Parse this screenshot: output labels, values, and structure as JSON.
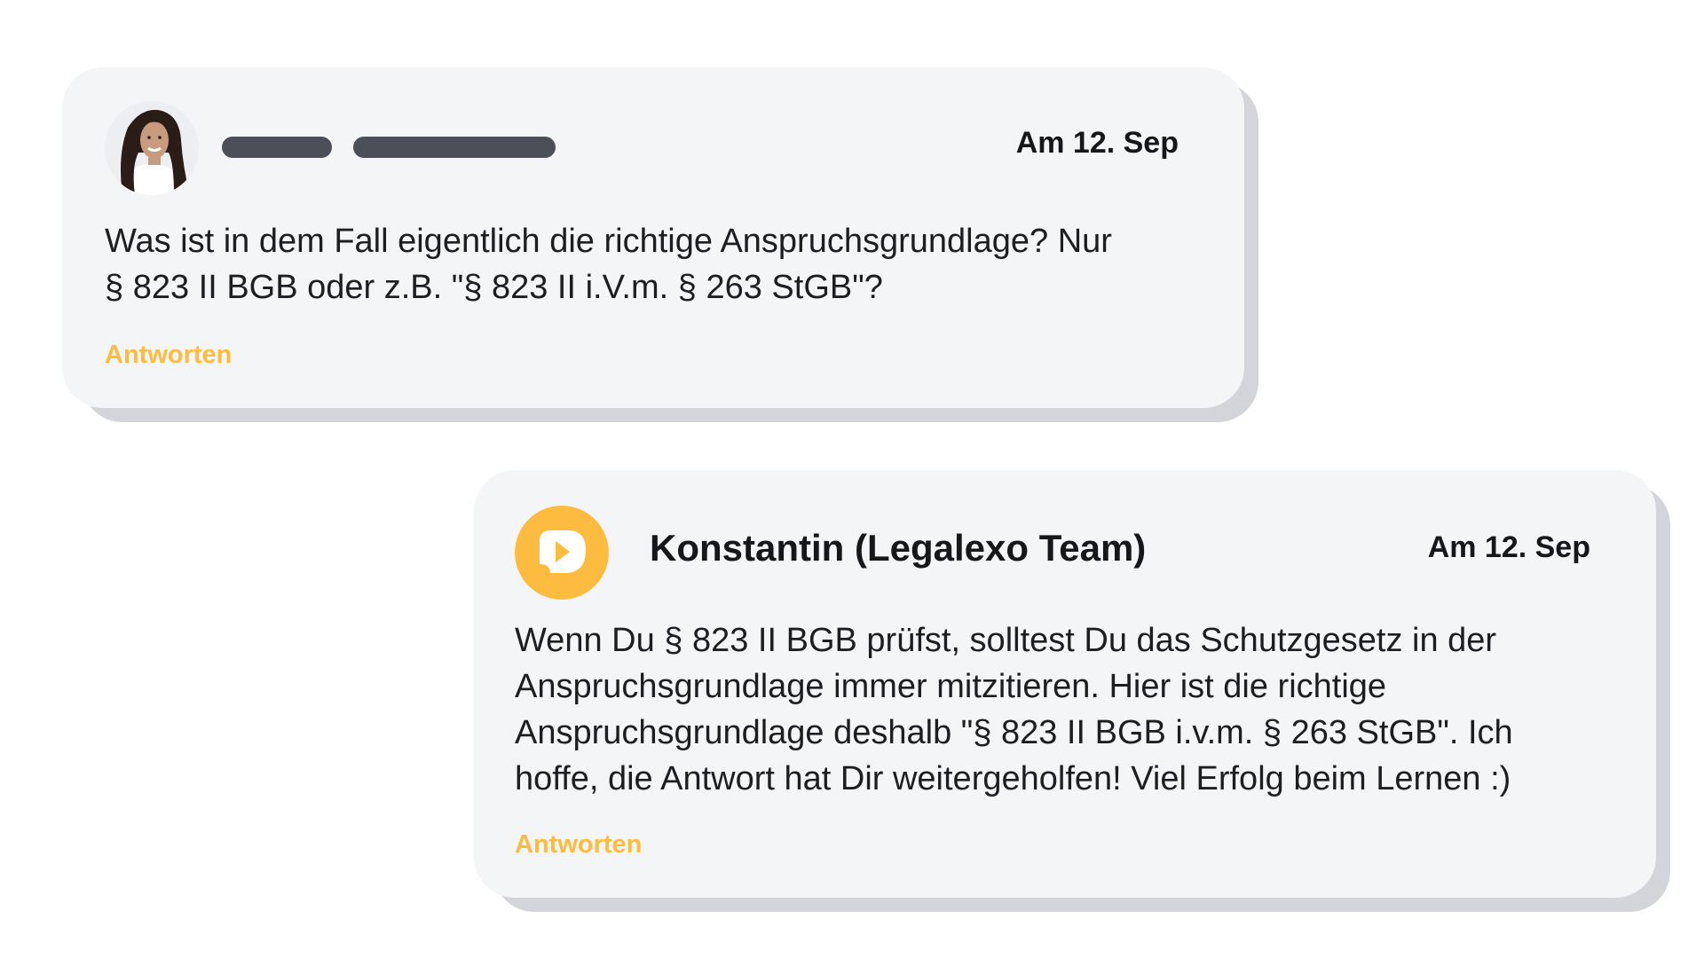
{
  "accent_color": "#fdbb3f",
  "comment": {
    "avatar": "user-avatar-photo",
    "date": "Am 12. Sep",
    "text_line1": "Was ist in dem Fall eigentlich die richtige Anspruchsgrundlage? Nur",
    "text_line2": "§ 823 II BGB oder z.B. \"§ 823 II i.V.m. § 263 StGB\"?",
    "reply_label": "Antworten"
  },
  "answer": {
    "avatar": "legalexo-logo-icon",
    "author": "Konstantin (Legalexo Team)",
    "date": "Am 12. Sep",
    "text_line1": "Wenn Du § 823 II BGB prüfst, solltest Du das Schutzgesetz in der",
    "text_line2": "Anspruchsgrundlage immer mitzitieren. Hier ist die richtige",
    "text_line3": "Anspruchsgrundlage deshalb \"§ 823 II BGB i.v.m. § 263 StGB\". Ich",
    "text_line4": "hoffe, die Antwort hat Dir weitergeholfen! Viel Erfolg beim Lernen :)",
    "reply_label": "Antworten"
  }
}
